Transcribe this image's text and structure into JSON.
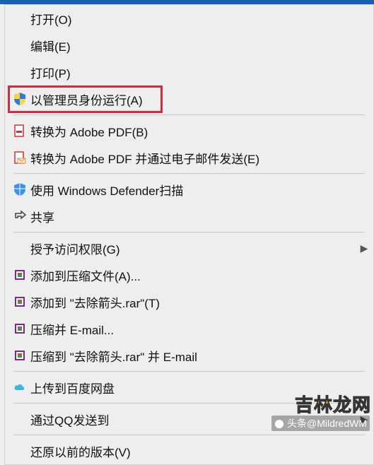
{
  "menu": {
    "open": {
      "label": "打开(O)"
    },
    "edit": {
      "label": "编辑(E)"
    },
    "print": {
      "label": "打印(P)"
    },
    "runas_admin": {
      "label": "以管理员身份运行(A)"
    },
    "pdf_convert": {
      "label": "转换为 Adobe PDF(B)"
    },
    "pdf_email": {
      "label": "转换为 Adobe PDF 并通过电子邮件发送(E)"
    },
    "defender": {
      "label": "使用 Windows Defender扫描"
    },
    "share": {
      "label": "共享"
    },
    "grant_access": {
      "label": "授予访问权限(G)"
    },
    "rar_add": {
      "label": "添加到压缩文件(A)..."
    },
    "rar_addto": {
      "label": "添加到 \"去除箭头.rar\"(T)"
    },
    "rar_email": {
      "label": "压缩并 E-mail..."
    },
    "rar_emailto": {
      "label": "压缩到 \"去除箭头.rar\" 并 E-mail"
    },
    "baidu": {
      "label": "上传到百度网盘"
    },
    "qq": {
      "label": "通过QQ发送到"
    },
    "restore": {
      "label": "还原以前的版本(V)"
    }
  },
  "watermark": {
    "site": "吉林龙网",
    "credit": "头条@MildredWM"
  }
}
